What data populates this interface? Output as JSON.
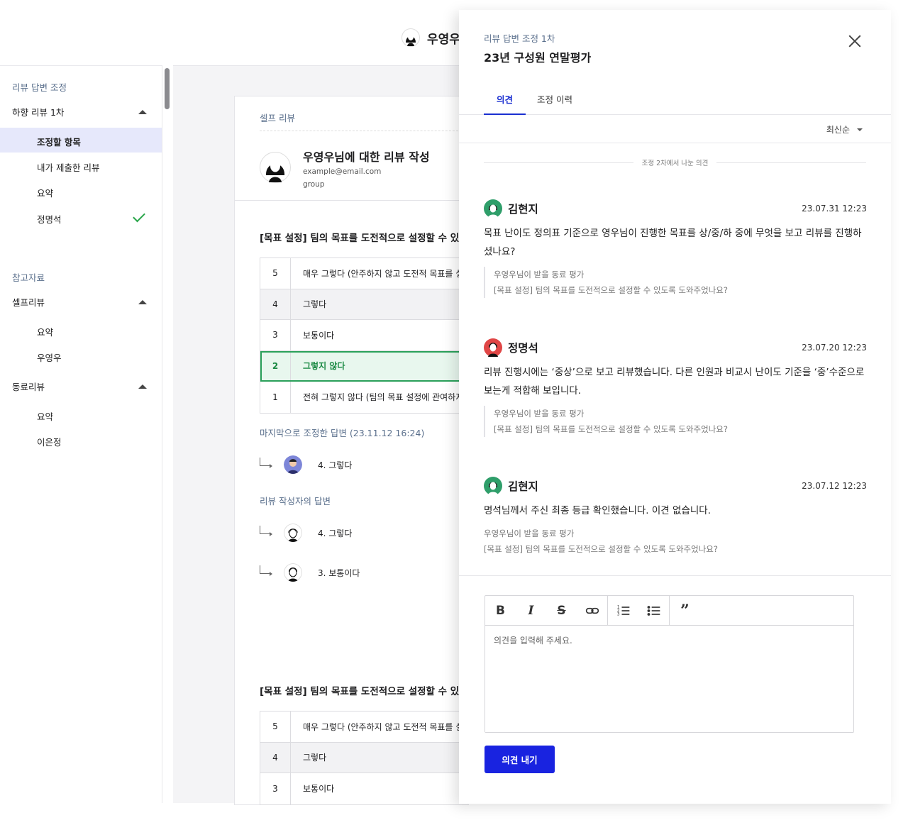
{
  "topbar": {
    "user_name": "우영우"
  },
  "sidebar": {
    "section1": "리뷰 답변 조정",
    "group1": "하향 리뷰 1차",
    "items1": [
      "조정할 항목",
      "내가 제출한 리뷰",
      "요약",
      "정명석"
    ],
    "section2": "참고자료",
    "group2": "셀프리뷰",
    "items2": [
      "요약",
      "우영우"
    ],
    "group3": "동료리뷰",
    "items3": [
      "요약",
      "이은정"
    ]
  },
  "main": {
    "card_label": "셀프 리뷰",
    "review_title": "우영우님에 대한 리뷰 작성",
    "email": "example@email.com",
    "group": "group",
    "question1": "[목표 설정] 팀의 목표를 도전적으로 설정할 수 있",
    "options1": [
      {
        "num": "5",
        "text": "매우 그렇다 (안주하지 않고 도전적 목표를 설"
      },
      {
        "num": "4",
        "text": "그렇다"
      },
      {
        "num": "3",
        "text": "보통이다"
      },
      {
        "num": "2",
        "text": "그렇지 않다"
      },
      {
        "num": "1",
        "text": "전혀 그렇지 않다 (팀의 목표 설정에 관여하지"
      }
    ],
    "last_adjusted_label": "마지막으로 조정한 답변 (23.11.12 16:24)",
    "last_adjusted_answer": "4. 그렇다",
    "author_answers_label": "리뷰 작성자의 답변",
    "author_answers": [
      "4. 그렇다",
      "3. 보통이다"
    ],
    "question2": "[목표 설정] 팀의 목표를 도전적으로 설정할 수 있",
    "options2": [
      {
        "num": "5",
        "text": "매우 그렇다 (안주하지 않고 도전적 목표를 설"
      },
      {
        "num": "4",
        "text": "그렇다"
      },
      {
        "num": "3",
        "text": "보통이다"
      }
    ]
  },
  "panel": {
    "subtitle": "리뷰 답변 조정 1차",
    "title": "23년 구성원 연말평가",
    "tabs": [
      "의견",
      "조정 이력"
    ],
    "sort_label": "최신순",
    "separator": "조정 2차에서 나눈 의견",
    "comments": [
      {
        "author": "김현지",
        "time": "23.07.31 12:23",
        "body": "목표 난이도 정의표 기준으로 영우님이 진행한 목표를 상/중/하 중에 무엇을 보고 리뷰를 진행하셨나요?",
        "quote1": "우영우님이 받을 동료 평가",
        "quote2": "[목표 설정] 팀의 목표를 도전적으로 설정할 수 있도록 도와주었나요?"
      },
      {
        "author": "정명석",
        "time": "23.07.20 12:23",
        "body": "리뷰 진행시에는 ‘중상’으로 보고 리뷰했습니다. 다른 인원과 비교시 난이도 기준을 ‘중’수준으로 보는게 적합해 보입니다.",
        "quote1": "우영우님이 받을 동료 평가",
        "quote2": "[목표 설정] 팀의 목표를 도전적으로 설정할 수 있도록 도와주었나요?"
      },
      {
        "author": "김현지",
        "time": "23.07.12 12:23",
        "body": "명석님께서 주신 최종 등급 확인했습니다. 이견 없습니다.",
        "quote1": "우영우님이 받을 동료 평가",
        "quote2": "[목표 설정] 팀의 목표를 도전적으로 설정할 수 있도록 도와주었나요?"
      }
    ],
    "editor_placeholder": "의견을 입력해 주세요.",
    "submit_label": "의견 내기"
  },
  "colors": {
    "accent": "#1923e0",
    "selected_green": "#2aa05a",
    "label_blue_gray": "#5a6f8c"
  },
  "icons": [
    "close-icon",
    "bold-icon",
    "italic-icon",
    "strikethrough-icon",
    "link-icon",
    "ordered-list-icon",
    "bullet-list-icon",
    "quote-icon",
    "check-icon",
    "chevron-up-icon",
    "caret-down-icon",
    "reply-arrow-icon"
  ]
}
